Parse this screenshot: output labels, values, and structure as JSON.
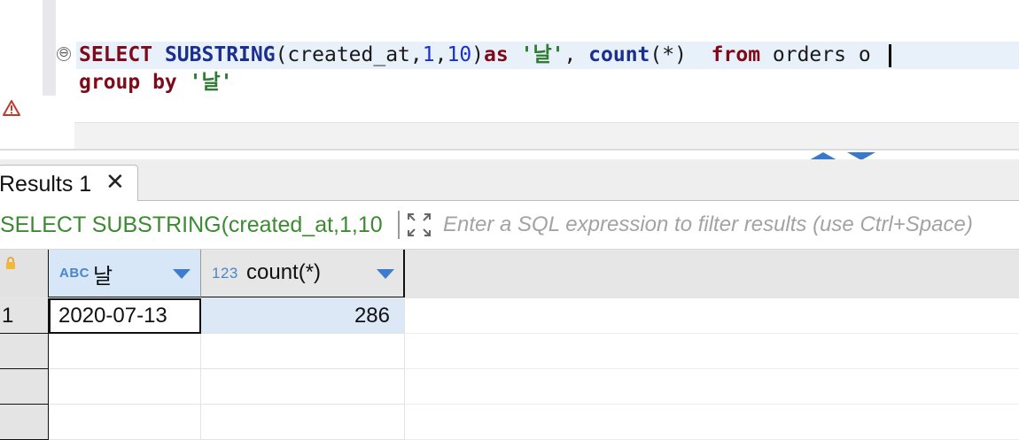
{
  "editor": {
    "line1": {
      "kw_select": "SELECT",
      "fn_substring": "SUBSTRING",
      "args_open": "(created_at,",
      "num1": "1",
      "comma": ",",
      "num2": "10",
      "args_close": ")",
      "kw_as": "as",
      "space1": " ",
      "str_alias": "'날'",
      "sep": ", ",
      "fn_count": "count",
      "count_args": "(*)  ",
      "kw_from": "from",
      "table": " orders o "
    },
    "line2": {
      "kw_group_by": "group by",
      "space": " ",
      "str_alias": "'날'"
    },
    "fold_symbol": "⊖",
    "icons": {
      "fold": "collapse-icon",
      "warning": "warning-icon",
      "panel_up": "maximize-editor-icon",
      "panel_down": "maximize-results-icon"
    },
    "colors": {
      "keyword": "#7f0a1a",
      "function": "#1a2f8f",
      "number": "#1a2fd0",
      "string": "#2e7d32",
      "current_line": "#e8f0fa"
    }
  },
  "results": {
    "tab": {
      "label": "Results 1",
      "close": "✕"
    },
    "filter": {
      "query_preview": "SELECT SUBSTRING(created_at,1,10",
      "placeholder": "Enter a SQL expression to filter results (use Ctrl+Space)"
    },
    "grid": {
      "columns": [
        {
          "type": "ABC",
          "name": "날"
        },
        {
          "type": "123",
          "name": "count(*)"
        }
      ],
      "rows": [
        {
          "num": "1",
          "values": [
            "2020-07-13",
            "286"
          ]
        },
        {
          "num": "",
          "values": [
            "",
            ""
          ]
        },
        {
          "num": "",
          "values": [
            "",
            ""
          ]
        },
        {
          "num": "",
          "values": [
            "",
            ""
          ]
        }
      ],
      "colors": {
        "selected_header": "#d7e7f8",
        "selected_cell": "#dce8f5",
        "type_badge": "#4a86c8"
      }
    }
  }
}
